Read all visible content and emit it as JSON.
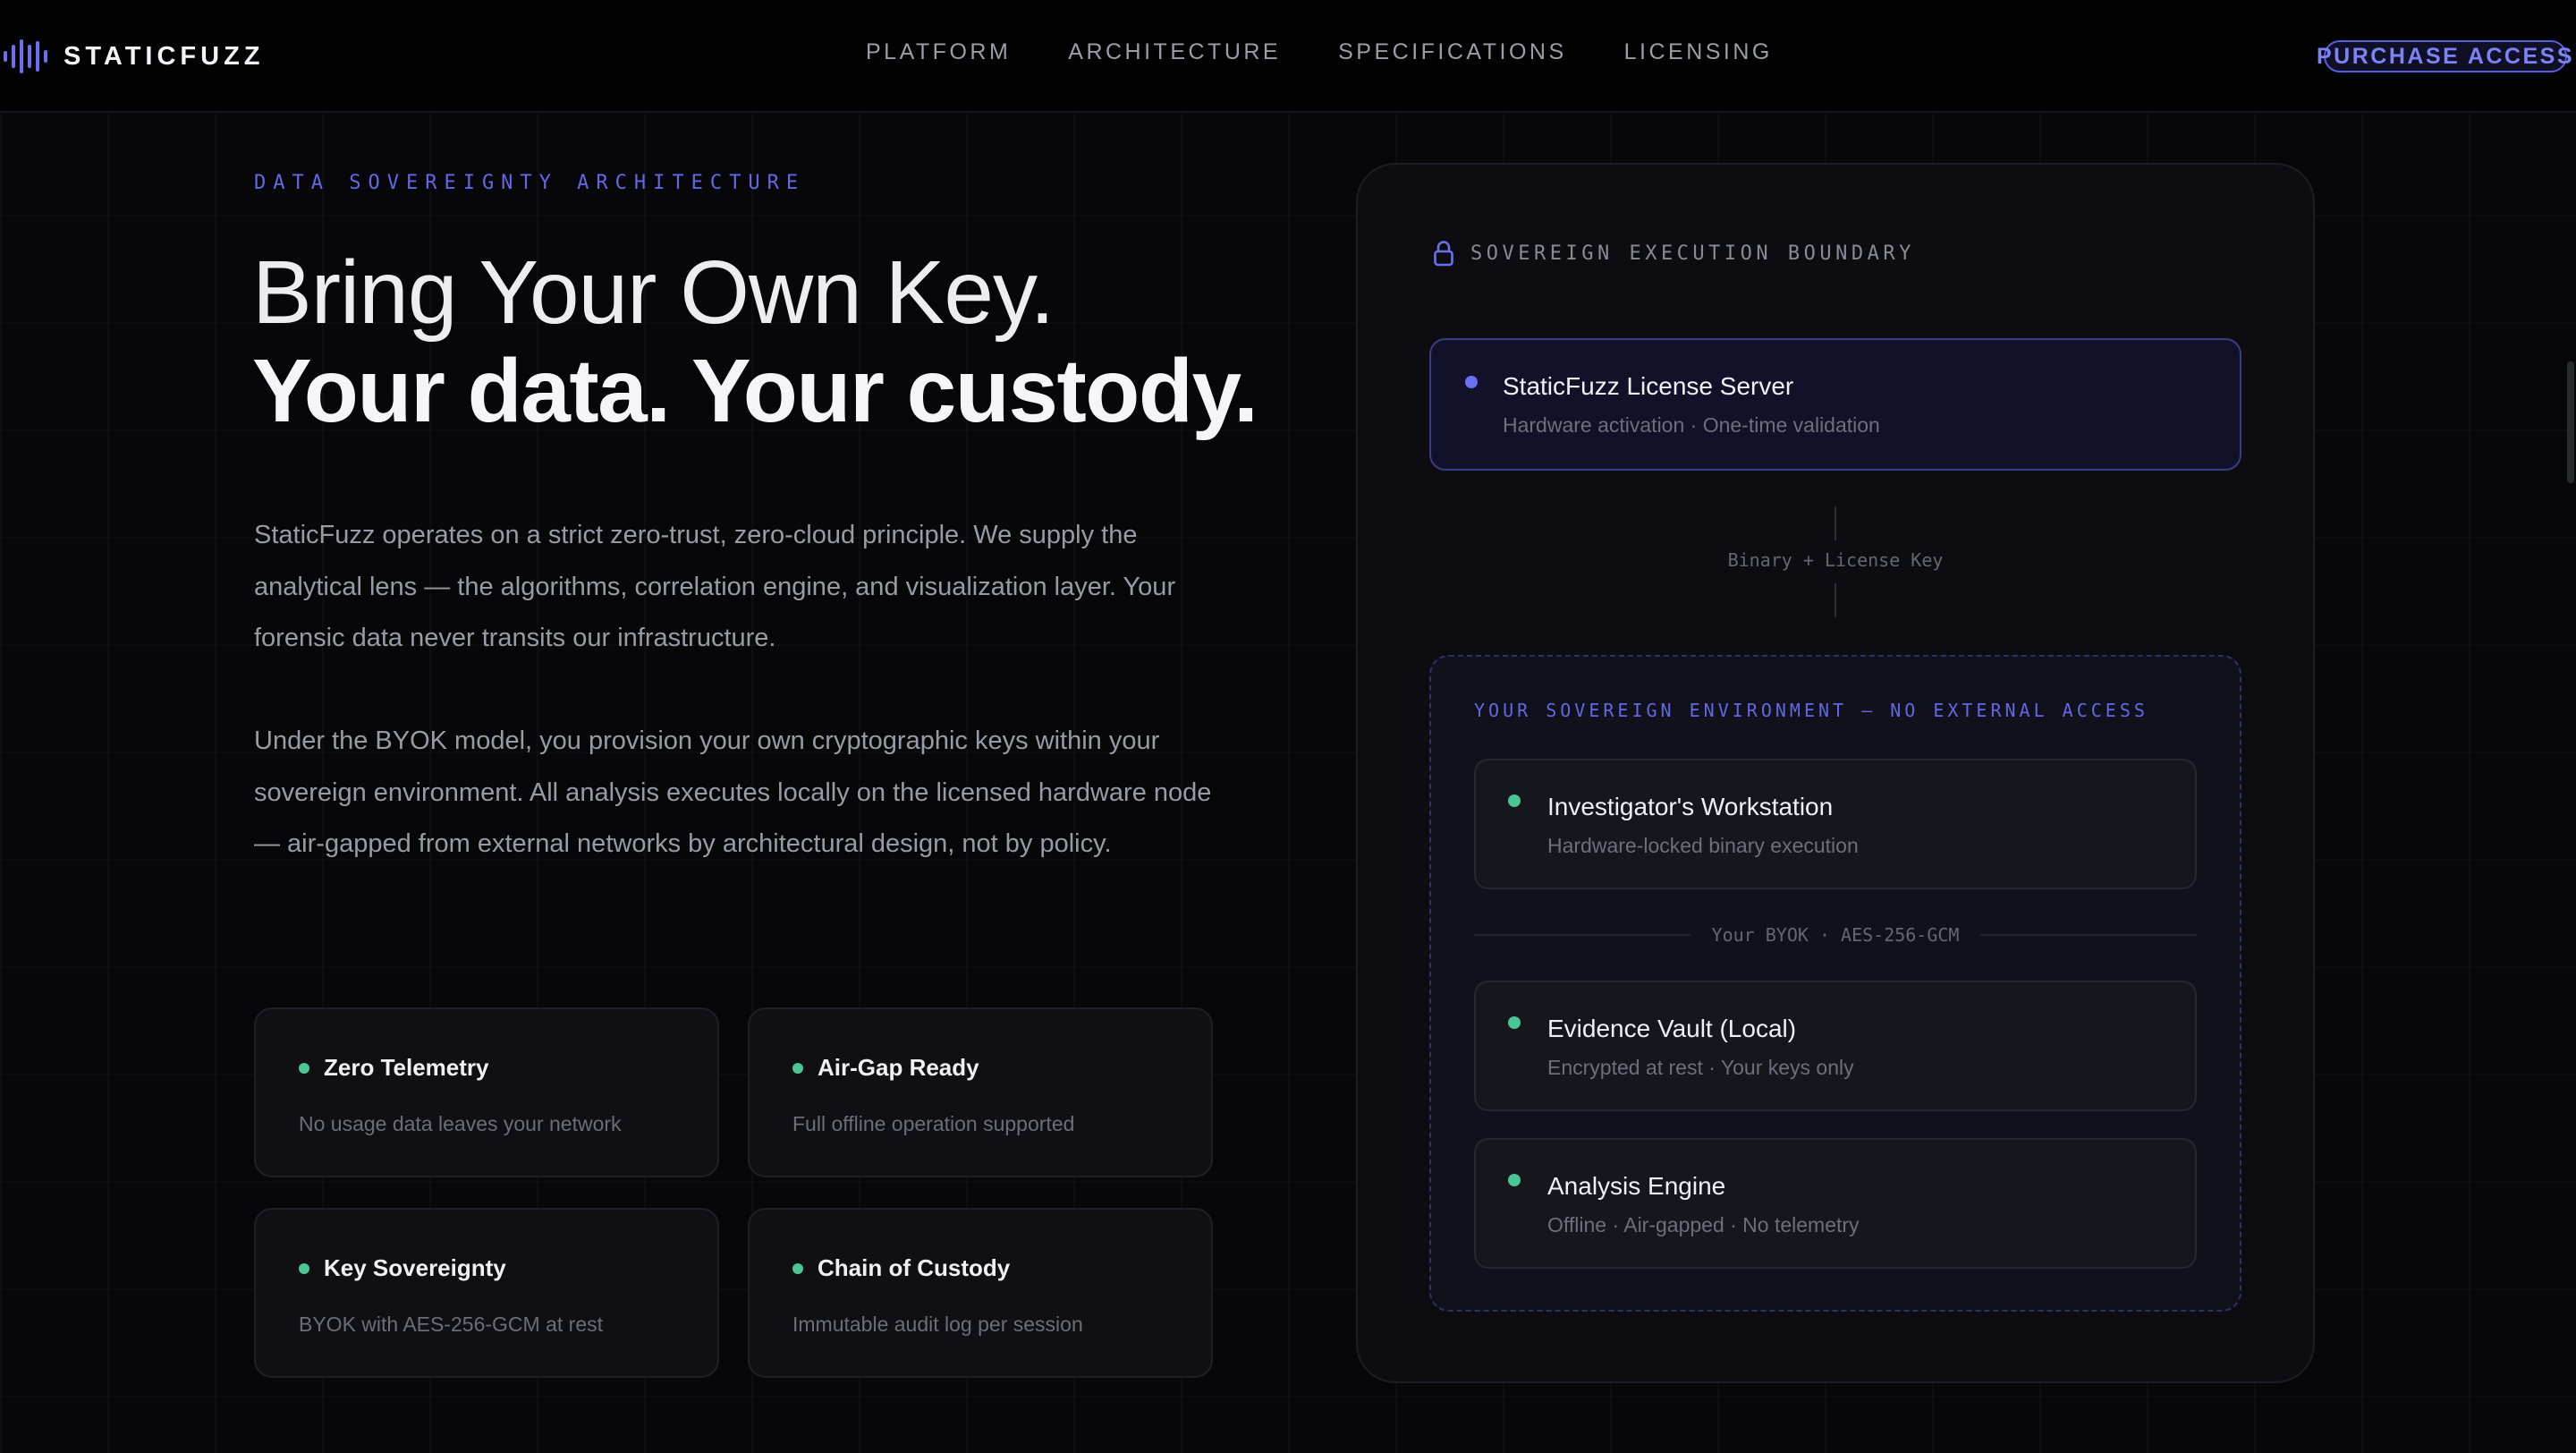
{
  "nav": {
    "brand": "STATICFUZZ",
    "links": [
      "PLATFORM",
      "ARCHITECTURE",
      "SPECIFICATIONS",
      "LICENSING"
    ],
    "cta": "PURCHASE ACCESS"
  },
  "hero": {
    "eyebrow": "DATA SOVEREIGNTY ARCHITECTURE",
    "headline_line1": "Bring Your Own Key.",
    "headline_line2": "Your data. Your custody.",
    "paragraph1": "StaticFuzz operates on a strict zero-trust, zero-cloud principle. We supply the analytical lens — the algorithms, correlation engine, and visualization layer. Your forensic data never transits our infrastructure.",
    "paragraph2": "Under the BYOK model, you provision your own cryptographic keys within your sovereign environment. All analysis executes locally on the licensed hardware node — air-gapped from external networks by architectural design, not by policy."
  },
  "features": [
    {
      "title": "Zero Telemetry",
      "desc": "No usage data leaves your network"
    },
    {
      "title": "Air-Gap Ready",
      "desc": "Full offline operation supported"
    },
    {
      "title": "Key Sovereignty",
      "desc": "BYOK with AES-256-GCM at rest"
    },
    {
      "title": "Chain of Custody",
      "desc": "Immutable audit log per session"
    }
  ],
  "panel": {
    "boundary_label": "SOVEREIGN EXECUTION BOUNDARY",
    "server": {
      "title": "StaticFuzz License Server",
      "sub": "Hardware activation · One-time validation"
    },
    "flow_label": "Binary + License Key",
    "env_label": "YOUR SOVEREIGN ENVIRONMENT — NO EXTERNAL ACCESS",
    "workstation": {
      "title": "Investigator's Workstation",
      "sub": "Hardware-locked binary execution"
    },
    "divider": "Your BYOK · AES-256-GCM",
    "vault": {
      "title": "Evidence Vault (Local)",
      "sub": "Encrypted at rest · Your keys only"
    },
    "engine": {
      "title": "Analysis Engine",
      "sub": "Offline · Air-gapped · No telemetry"
    }
  },
  "colors": {
    "accent": "#6367e6",
    "status_green": "#4cc594",
    "background": "#07070a"
  },
  "icons": {
    "brand": "waveform-icon",
    "boundary": "lock-icon"
  }
}
